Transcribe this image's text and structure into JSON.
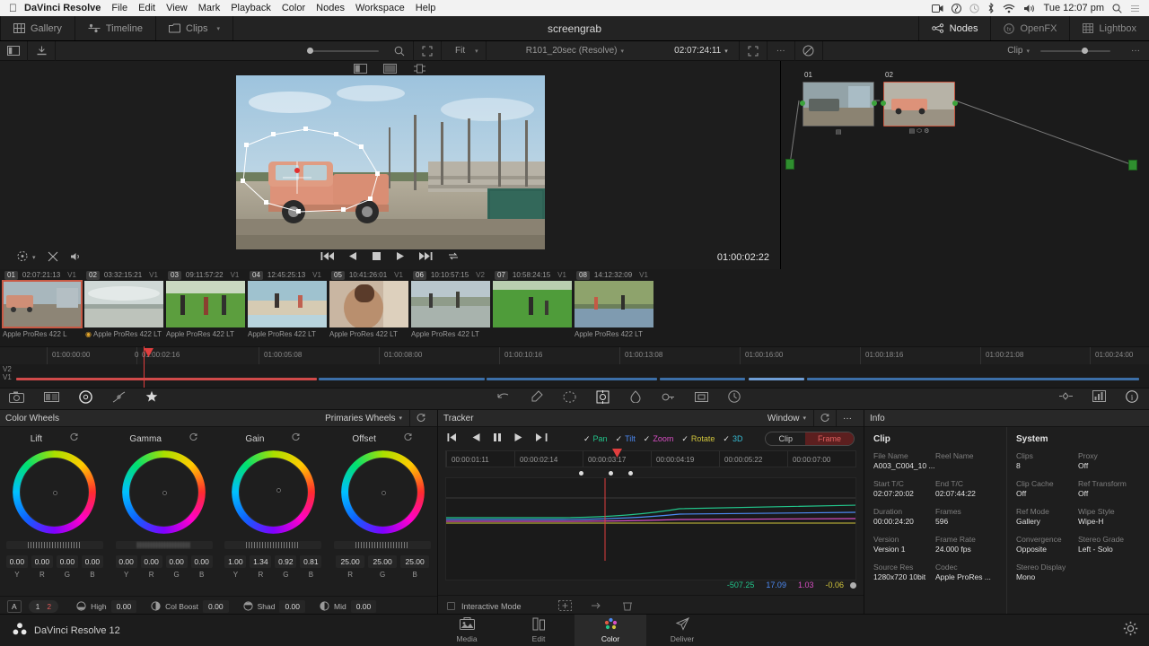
{
  "menubar": {
    "apple_icon": "apple-logo-icon",
    "app_name": "DaVinci Resolve",
    "items": [
      "File",
      "Edit",
      "View",
      "Mark",
      "Playback",
      "Color",
      "Nodes",
      "Workspace",
      "Help"
    ],
    "status_icons": [
      "screen-record-icon",
      "dropbox-icon",
      "time-machine-icon",
      "bluetooth-icon",
      "wifi-icon",
      "volume-icon"
    ],
    "clock": "Tue 12:07 pm",
    "search_icon": "search-icon",
    "list_icon": "notification-center-icon"
  },
  "titlebar": {
    "left_buttons": [
      {
        "label": "Gallery",
        "icon": "gallery-icon"
      },
      {
        "label": "Timeline",
        "icon": "timeline-icon"
      },
      {
        "label": "Clips",
        "icon": "clips-icon",
        "chevron": "▾"
      }
    ],
    "project_title": "screengrab",
    "right_buttons": [
      {
        "label": "Nodes",
        "icon": "nodes-icon",
        "active": true
      },
      {
        "label": "OpenFX",
        "icon": "openfx-icon",
        "active": false
      },
      {
        "label": "Lightbox",
        "icon": "lightbox-icon",
        "active": false
      }
    ]
  },
  "viewer_toolbar": {
    "sidebar_icon": "panel-toggle-icon",
    "import_icon": "import-still-icon",
    "search_icon": "search-icon",
    "fullscreen_icon": "expand-icon",
    "fit_label": "Fit",
    "clip_name": "R101_20sec (Resolve)",
    "clip_name_chevron": "▾",
    "timecode": "02:07:24:11",
    "timecode_chevron": "▾",
    "expand_icon": "expand-icon",
    "more_icon": "more-options-icon",
    "bypass_icon": "bypass-icon",
    "clip_label": "Clip",
    "clip_chevron": "▾"
  },
  "viewer": {
    "mode_icons": [
      "split-view-icon",
      "image-view-icon",
      "node-view-icon"
    ],
    "transport": {
      "window_icon": "power-window-icon",
      "window_chevron": "▾",
      "clear_icon": "clear-window-icon",
      "volume_icon": "volume-icon",
      "buttons": [
        "skip-to-start-icon",
        "play-reverse-icon",
        "stop-icon",
        "play-icon",
        "skip-to-end-icon",
        "loop-icon"
      ],
      "timecode": "01:00:02:22"
    }
  },
  "node_graph": {
    "nodes": [
      {
        "label": "01",
        "selected": false,
        "badges": "▤"
      },
      {
        "label": "02",
        "selected": true,
        "badges": "▤ ⬭ ⚙"
      }
    ]
  },
  "thumbnails": [
    {
      "num": "01",
      "timecode": "02:07:21:13",
      "track": "V1",
      "codec": "Apple ProRes 422 L",
      "selected": true,
      "marker": false
    },
    {
      "num": "02",
      "timecode": "03:32:15:21",
      "track": "V1",
      "codec": "Apple ProRes 422 LT",
      "selected": false,
      "marker": true
    },
    {
      "num": "03",
      "timecode": "09:11:57:22",
      "track": "V1",
      "codec": "Apple ProRes 422 LT",
      "selected": false,
      "marker": false
    },
    {
      "num": "04",
      "timecode": "12:45:25:13",
      "track": "V1",
      "codec": "Apple ProRes 422 LT",
      "selected": false,
      "marker": false
    },
    {
      "num": "05",
      "timecode": "10:41:26:01",
      "track": "V1",
      "codec": "Apple ProRes 422 LT",
      "selected": false,
      "marker": false
    },
    {
      "num": "06",
      "timecode": "10:10:57:15",
      "track": "V2",
      "codec": "Apple ProRes 422 LT",
      "selected": false,
      "marker": false
    },
    {
      "num": "07",
      "timecode": "10:58:24:15",
      "track": "V1",
      "codec": "",
      "selected": false,
      "marker": false
    },
    {
      "num": "08",
      "timecode": "14:12:32:09",
      "track": "V1",
      "codec": "Apple ProRes 422 LT",
      "selected": false,
      "marker": false
    }
  ],
  "timeline": {
    "ruler_ticks": [
      "01:00:00:00",
      "01:00:02:16",
      "01:00:05:08",
      "01:00:08:00",
      "01:00:10:16",
      "01:00:13:08",
      "01:00:16:00",
      "01:00:18:16",
      "01:00:21:08",
      "01:00:24:00"
    ],
    "tracks": [
      "V2",
      "V1"
    ],
    "playhead_label": "0"
  },
  "palette_toolbar": {
    "left_icons": [
      "camera-raw-icon",
      "color-match-icon",
      "color-wheels-icon",
      "curves-icon",
      "qualifier-star-icon"
    ],
    "mid_icons": [
      "undo-icon",
      "eyedropper-icon",
      "window-icon",
      "tracker-icon",
      "blur-icon",
      "key-icon",
      "sizing-icon",
      "data-burn-icon"
    ],
    "right_icons": [
      "keyframes-icon",
      "scopes-icon",
      "info-circle-icon"
    ]
  },
  "color_wheels": {
    "title": "Color Wheels",
    "mode": "Primaries Wheels",
    "mode_chevron": "▾",
    "reset_icon": "reset-icon",
    "wheels": [
      {
        "name": "Lift",
        "reset_icon": "reset-icon",
        "values": [
          "0.00",
          "0.00",
          "0.00",
          "0.00"
        ],
        "labels": [
          "Y",
          "R",
          "G",
          "B"
        ]
      },
      {
        "name": "Gamma",
        "reset_icon": "reset-icon",
        "values": [
          "0.00",
          "0.00",
          "0.00",
          "0.00"
        ],
        "labels": [
          "Y",
          "R",
          "G",
          "B"
        ]
      },
      {
        "name": "Gain",
        "reset_icon": "reset-icon",
        "values": [
          "1.00",
          "1.34",
          "0.92",
          "0.81"
        ],
        "labels": [
          "Y",
          "R",
          "G",
          "B"
        ]
      },
      {
        "name": "Offset",
        "reset_icon": "reset-icon",
        "values": [
          "25.00",
          "25.00",
          "25.00"
        ],
        "labels": [
          "R",
          "G",
          "B"
        ]
      }
    ],
    "footer": {
      "ab_label": "A",
      "versions": [
        "1",
        "2"
      ],
      "active_version": "2",
      "controls": [
        {
          "icon": "highlight-icon",
          "label": "High",
          "value": "0.00"
        },
        {
          "icon": "color-boost-icon",
          "label": "Col Boost",
          "value": "0.00"
        },
        {
          "icon": "shadow-icon",
          "label": "Shad",
          "value": "0.00"
        },
        {
          "icon": "midtone-icon",
          "label": "Mid",
          "value": "0.00"
        }
      ]
    }
  },
  "tracker": {
    "title": "Tracker",
    "mode": "Window",
    "mode_chevron": "▾",
    "reset_icon": "reset-icon",
    "more_icon": "more-options-icon",
    "transport_icons": [
      "track-reverse-end-icon",
      "track-reverse-icon",
      "pause-icon",
      "track-forward-icon",
      "track-forward-end-icon"
    ],
    "checks": [
      {
        "label": "Pan",
        "color": "#22c58b",
        "checked": true
      },
      {
        "label": "Tilt",
        "color": "#4d8bf5",
        "checked": true
      },
      {
        "label": "Zoom",
        "color": "#d94ec4",
        "checked": true
      },
      {
        "label": "Rotate",
        "color": "#d1c53c",
        "checked": true
      },
      {
        "label": "3D",
        "color": "#36bcd4",
        "checked": true
      }
    ],
    "segments": {
      "clip": "Clip",
      "frame": "Frame",
      "active": "Frame"
    },
    "ruler_ticks": [
      "00:00:01:11",
      "00:00:02:14",
      "00:00:03:17",
      "00:00:04:19",
      "00:00:05:22",
      "00:00:07:00"
    ],
    "values": [
      {
        "value": "-507.25",
        "color": "#22c58b"
      },
      {
        "value": "17.09",
        "color": "#4d8bf5"
      },
      {
        "value": "1.03",
        "color": "#d94ec4"
      },
      {
        "value": "-0.06",
        "color": "#d1c53c"
      }
    ],
    "footer": {
      "interactive_label": "Interactive Mode",
      "interactive_checked": false,
      "icons": [
        "insert-point-icon",
        "delete-point-icon",
        "clear-track-icon"
      ]
    }
  },
  "info": {
    "title": "Info",
    "clip": {
      "title": "Clip",
      "fields": [
        {
          "key": "File Name",
          "value": "A003_C004_10 ..."
        },
        {
          "key": "Reel Name",
          "value": ""
        },
        {
          "key": "Start T/C",
          "value": "02:07:20:02"
        },
        {
          "key": "End T/C",
          "value": "02:07:44:22"
        },
        {
          "key": "Duration",
          "value": "00:00:24:20"
        },
        {
          "key": "Frames",
          "value": "596"
        },
        {
          "key": "Version",
          "value": "Version 1"
        },
        {
          "key": "Frame Rate",
          "value": "24.000 fps"
        },
        {
          "key": "Source Res",
          "value": "1280x720 10bit"
        },
        {
          "key": "Codec",
          "value": "Apple ProRes ..."
        }
      ]
    },
    "system": {
      "title": "System",
      "fields": [
        {
          "key": "Clips",
          "value": "8"
        },
        {
          "key": "Proxy",
          "value": "Off"
        },
        {
          "key": "Clip Cache",
          "value": "Off"
        },
        {
          "key": "Ref Transform",
          "value": "Off"
        },
        {
          "key": "Ref Mode",
          "value": "Gallery"
        },
        {
          "key": "Wipe Style",
          "value": "Wipe-H"
        },
        {
          "key": "Convergence",
          "value": "Opposite"
        },
        {
          "key": "Stereo Grade",
          "value": "Left - Solo"
        },
        {
          "key": "Stereo Display",
          "value": "Mono"
        }
      ]
    }
  },
  "bottombar": {
    "brand": "DaVinci Resolve 12",
    "brand_icon": "resolve-logo-icon",
    "pages": [
      {
        "label": "Media",
        "icon": "media-page-icon",
        "active": false
      },
      {
        "label": "Edit",
        "icon": "edit-page-icon",
        "active": false
      },
      {
        "label": "Color",
        "icon": "color-page-icon",
        "active": true
      },
      {
        "label": "Deliver",
        "icon": "deliver-page-icon",
        "active": false
      }
    ],
    "settings_icon": "gear-icon"
  }
}
